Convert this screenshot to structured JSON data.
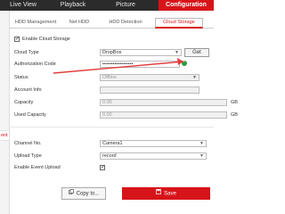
{
  "topnav": {
    "tabs": [
      {
        "label": "Live View"
      },
      {
        "label": "Playback"
      },
      {
        "label": "Picture"
      },
      {
        "label": "Configuration"
      }
    ]
  },
  "leftpanel": {
    "partial_label": "ent"
  },
  "subtabs": [
    {
      "label": "HDD Management"
    },
    {
      "label": "Net HDD"
    },
    {
      "label": "HDD Detection"
    },
    {
      "label": "Cloud Storage"
    }
  ],
  "cloud": {
    "enable_label": "Enable Cloud Storage",
    "cloud_type": {
      "label": "Cloud Type",
      "value": "DropBox"
    },
    "get_label": "Get",
    "auth_code": {
      "label": "Authorization Code",
      "value": "••••••••••••••••••"
    },
    "status": {
      "label": "Status",
      "value": "Offline"
    },
    "account": {
      "label": "Account Info",
      "value": ""
    },
    "capacity": {
      "label": "Capacity",
      "value": "0.00",
      "unit": "GB"
    },
    "used_capacity": {
      "label": "Used Capacity",
      "value": "0.00",
      "unit": "GB"
    }
  },
  "upload": {
    "channel": {
      "label": "Channel No.",
      "value": "Camera1"
    },
    "type": {
      "label": "Upload Type",
      "value": "record"
    },
    "event": {
      "label": "Enable Event Upload"
    }
  },
  "buttons": {
    "copy": "Copy to...",
    "save": "Save"
  },
  "colors": {
    "accent": "#d7141a",
    "nav_bg": "#2b2b2b",
    "ok_green": "#2a9c3a"
  }
}
